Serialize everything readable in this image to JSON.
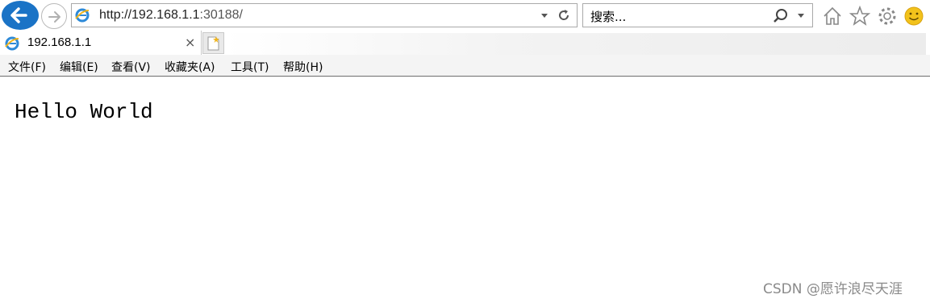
{
  "browser": {
    "address_bar": {
      "url_host": "http://192.168.1.1",
      "url_port": ":30188/"
    },
    "search_bar": {
      "placeholder": "搜索..."
    },
    "tab": {
      "title": "192.168.1.1",
      "close_glyph": "×"
    },
    "menu": [
      {
        "label": "文件(F)"
      },
      {
        "label": "编辑(E)"
      },
      {
        "label": "查看(V)"
      },
      {
        "label": "收藏夹(A)"
      },
      {
        "label": "工具(T)"
      },
      {
        "label": "帮助(H)"
      }
    ],
    "icons": [
      "back-arrow-icon",
      "forward-arrow-icon",
      "ie-logo-icon",
      "dropdown-icon",
      "refresh-icon",
      "search-icon",
      "home-icon",
      "star-icon",
      "gear-icon",
      "smiley-icon",
      "new-tab-icon"
    ],
    "colors": {
      "back_button": "#1a73c6",
      "accent_icon": "#f2c21b"
    }
  },
  "page": {
    "body_text": "Hello World"
  },
  "watermark": {
    "text": "CSDN @愿许浪尽天涯"
  }
}
